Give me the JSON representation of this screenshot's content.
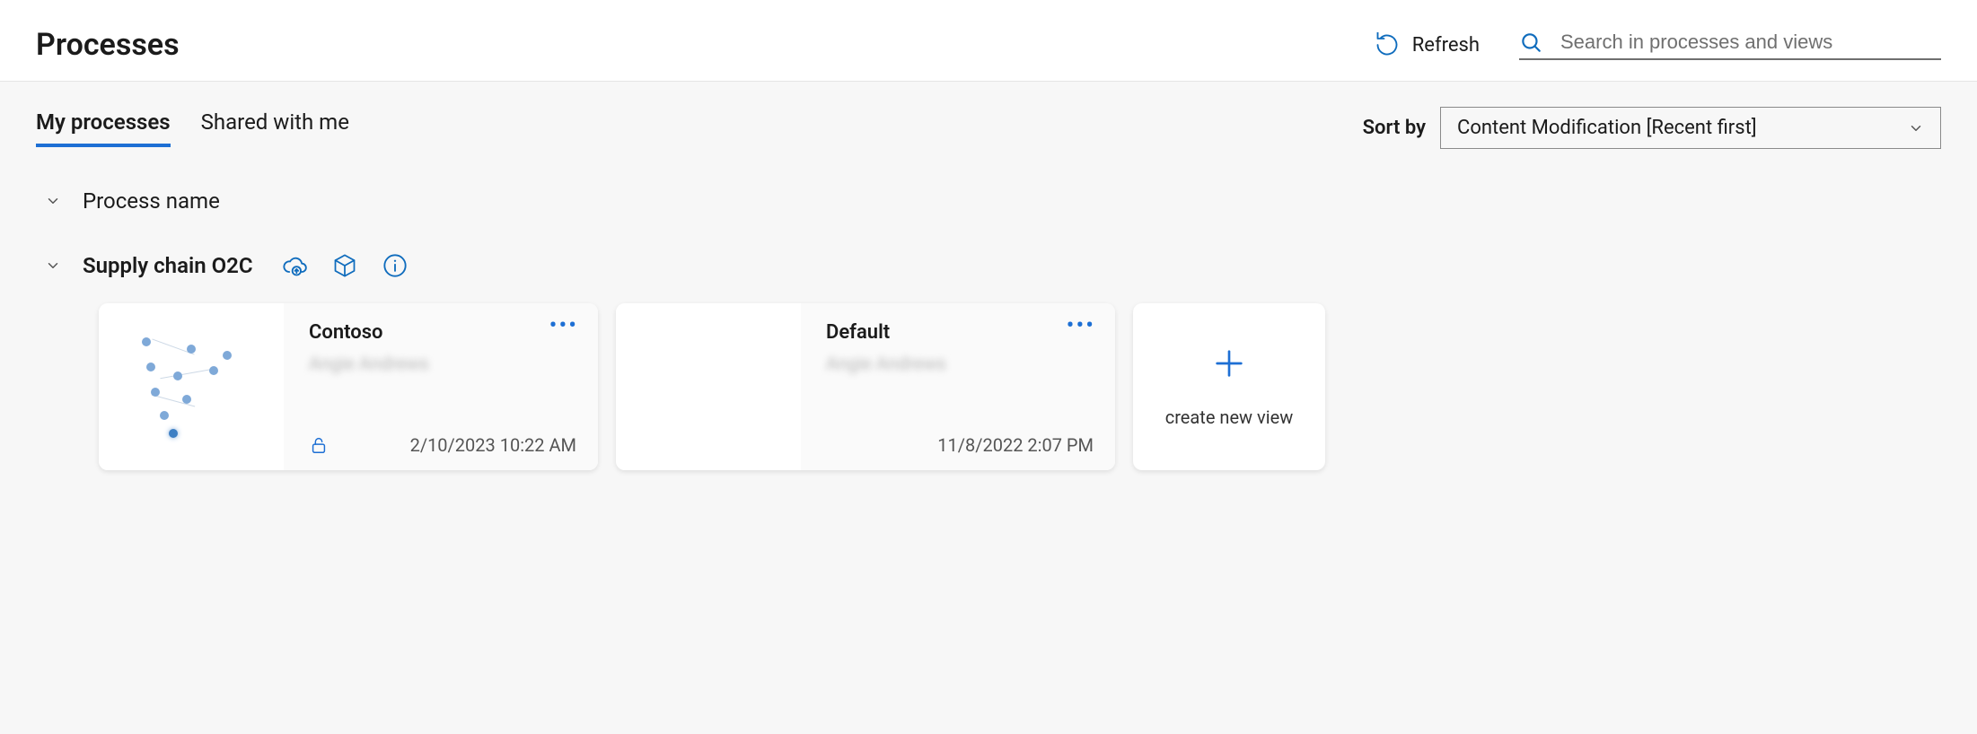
{
  "header": {
    "title": "Processes",
    "refresh_label": "Refresh",
    "search_placeholder": "Search in processes and views"
  },
  "tabs": {
    "my_processes": "My processes",
    "shared_with_me": "Shared with me"
  },
  "sort": {
    "label": "Sort by",
    "selected": "Content Modification [Recent first]"
  },
  "section": {
    "process_name_header": "Process name"
  },
  "process": {
    "name": "Supply chain O2C"
  },
  "cards": [
    {
      "title": "Contoso",
      "author": "Angie Andrews",
      "date": "2/10/2023 10:22 AM",
      "locked": true
    },
    {
      "title": "Default",
      "author": "Angie Andrews",
      "date": "11/8/2022 2:07 PM",
      "locked": false
    }
  ],
  "new_view_label": "create new view"
}
